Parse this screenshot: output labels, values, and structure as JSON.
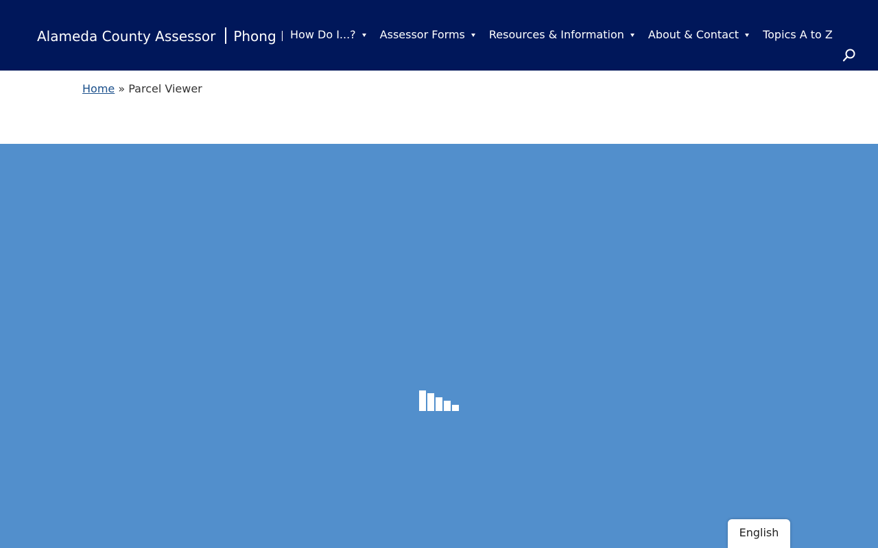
{
  "header": {
    "site_title": "Alameda County Assessor",
    "assessor_name_partial": "Phong L",
    "nav": [
      {
        "label": "How Do I...?",
        "has_dropdown": true
      },
      {
        "label": "Assessor Forms",
        "has_dropdown": true
      },
      {
        "label": "Resources & Information",
        "has_dropdown": true
      },
      {
        "label": "About & Contact",
        "has_dropdown": true
      },
      {
        "label": "Topics A to Z",
        "has_dropdown": false
      }
    ],
    "search_icon": "search-icon"
  },
  "breadcrumb": {
    "home": "Home",
    "separator": "»",
    "current": "Parcel Viewer"
  },
  "viewer": {
    "loading_icon": "loading-bars-icon"
  },
  "language": {
    "selected": "English"
  },
  "colors": {
    "header_bg": "#00175a",
    "viewer_bg": "#528fcc",
    "link": "#1a4f8b"
  }
}
